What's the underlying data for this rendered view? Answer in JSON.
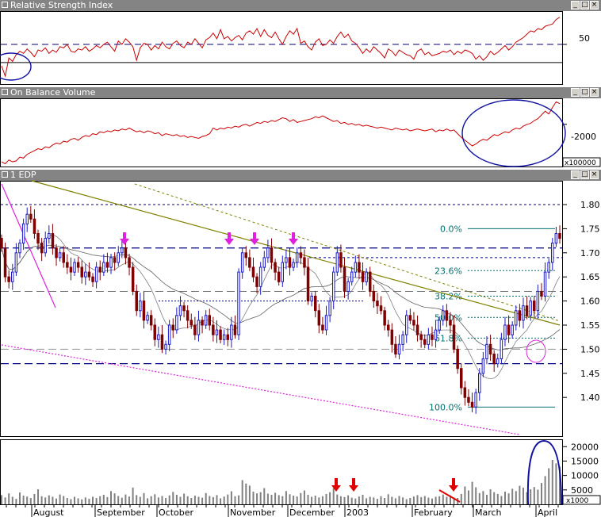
{
  "panels": {
    "rsi": {
      "title": "Relative Strength Index",
      "tick_label": "50"
    },
    "obv": {
      "title": "On Balance Volume",
      "tick_label": "-2000",
      "scale_label": "x100000"
    },
    "price": {
      "title": "1 EDP"
    },
    "volume": {
      "scale_label": "x1000"
    }
  },
  "window_controls": {
    "minimize": "_",
    "maximize": "□",
    "close": "×"
  },
  "colors": {
    "titlebar": "#848484",
    "rsi_line": "#cc0000",
    "obv_line": "#cc0000",
    "candle_up": "#1a1ac8",
    "candle_down": "#800000",
    "trend_olive": "#808000",
    "support_magenta": "#e020e0",
    "ellipse_navy": "#1010a0",
    "fib_teal": "#007070",
    "ma_gray": "#808080",
    "annotation_red": "#e00000",
    "grid_navy": "#000080"
  },
  "x_axis_labels": [
    "August",
    "September",
    "October",
    "November",
    "December",
    "2003",
    "February",
    "March",
    "April"
  ],
  "chart_data": [
    {
      "type": "line",
      "title": "Relative Strength Index",
      "yticks": [
        50
      ],
      "series": [
        {
          "values": [
            31,
            22,
            38,
            35,
            41,
            44,
            42,
            46,
            43,
            39,
            45,
            44,
            47,
            42,
            45,
            43,
            48,
            47,
            50,
            44,
            43,
            46,
            45,
            48,
            44,
            46,
            49,
            47,
            50,
            52,
            48,
            44,
            53,
            50,
            55,
            52,
            48,
            36,
            47,
            51,
            50,
            45,
            49,
            46,
            52,
            48,
            46,
            51,
            53,
            49,
            47,
            52,
            50,
            55,
            51,
            47,
            54,
            56,
            60,
            55,
            63,
            55,
            57,
            53,
            56,
            58,
            54,
            60,
            62,
            59,
            64,
            57,
            63,
            58,
            56,
            61,
            55,
            50,
            57,
            62,
            59,
            64,
            51,
            53,
            48,
            45,
            52,
            55,
            49,
            50,
            54,
            51,
            57,
            61,
            56,
            59,
            53,
            51,
            47,
            42,
            46,
            43,
            48,
            45,
            42,
            38,
            46,
            44,
            40,
            45,
            43,
            41,
            40,
            37,
            44,
            46,
            41,
            43,
            40,
            41,
            42,
            44,
            43,
            45,
            41,
            44,
            42,
            45,
            44,
            42,
            37,
            40,
            36,
            39,
            44,
            41,
            43,
            46,
            49,
            45,
            48,
            52,
            54,
            56,
            59,
            62,
            61,
            64,
            63,
            66,
            67,
            68,
            72,
            74
          ]
        }
      ]
    },
    {
      "type": "line",
      "title": "On Balance Volume",
      "yticks": [
        -2000
      ],
      "series": [
        {
          "values": [
            -2400,
            -2420,
            -2380,
            -2400,
            -2390,
            -2350,
            -2360,
            -2320,
            -2300,
            -2280,
            -2260,
            -2270,
            -2240,
            -2250,
            -2220,
            -2200,
            -2210,
            -2180,
            -2190,
            -2160,
            -2150,
            -2170,
            -2140,
            -2120,
            -2130,
            -2100,
            -2110,
            -2080,
            -2090,
            -2070,
            -2080,
            -2060,
            -2070,
            -2050,
            -2060,
            -2040,
            -2060,
            -2080,
            -2070,
            -2090,
            -2070,
            -2080,
            -2100,
            -2090,
            -2120,
            -2100,
            -2110,
            -2120,
            -2110,
            -2130,
            -2120,
            -2140,
            -2130,
            -2140,
            -2150,
            -2130,
            -2120,
            -2100,
            -2040,
            -2060,
            -2040,
            -2050,
            -2030,
            -2040,
            -2020,
            -2030,
            -2010,
            -2000,
            -2020,
            -2000,
            -1980,
            -1990,
            -1970,
            -1980,
            -1960,
            -1970,
            -1950,
            -1930,
            -1940,
            -1970,
            -1950,
            -1980,
            -1970,
            -1960,
            -1950,
            -1940,
            -1920,
            -1930,
            -1910,
            -1930,
            -1950,
            -1970,
            -1960,
            -1990,
            -1980,
            -2000,
            -1990,
            -2010,
            -2000,
            -2020,
            -2010,
            -2020,
            -2030,
            -2040,
            -2030,
            -2040,
            -2050,
            -2060,
            -2040,
            -2050,
            -2060,
            -2050,
            -2070,
            -2060,
            -2050,
            -2060,
            -2070,
            -2060,
            -2050,
            -2080,
            -2060,
            -2070,
            -2050,
            -2070,
            -2060,
            -2100,
            -2140,
            -2170,
            -2200,
            -2230,
            -2210,
            -2180,
            -2160,
            -2170,
            -2140,
            -2110,
            -2120,
            -2100,
            -2080,
            -2090,
            -2060,
            -2040,
            -2050,
            -2020,
            -2000,
            -1990,
            -1960,
            -1940,
            -1900,
            -1860,
            -1890,
            -1820,
            -1760,
            -1780
          ]
        }
      ]
    },
    {
      "type": "candlestick",
      "title": "1 EDP",
      "yticks": [
        1.4,
        1.45,
        1.5,
        1.55,
        1.6,
        1.65,
        1.7,
        1.75,
        1.8
      ],
      "fib_levels": [
        {
          "label": "0.0%",
          "value": 1.75
        },
        {
          "label": "23.6%",
          "value": 1.663
        },
        {
          "label": "38.2%",
          "value": 1.61
        },
        {
          "label": "50.0%",
          "value": 1.566
        },
        {
          "label": "61.8%",
          "value": 1.523
        },
        {
          "label": "100.0%",
          "value": 1.38
        }
      ],
      "horizontal_levels": [
        1.8,
        1.71,
        1.69,
        1.62,
        1.6,
        1.5,
        1.47
      ],
      "close": [
        1.71,
        1.65,
        1.64,
        1.66,
        1.7,
        1.72,
        1.76,
        1.78,
        1.77,
        1.74,
        1.72,
        1.7,
        1.73,
        1.74,
        1.71,
        1.69,
        1.7,
        1.68,
        1.67,
        1.66,
        1.68,
        1.67,
        1.65,
        1.66,
        1.65,
        1.64,
        1.67,
        1.66,
        1.68,
        1.67,
        1.69,
        1.68,
        1.7,
        1.71,
        1.69,
        1.67,
        1.62,
        1.58,
        1.6,
        1.56,
        1.57,
        1.55,
        1.52,
        1.53,
        1.5,
        1.51,
        1.55,
        1.54,
        1.57,
        1.59,
        1.58,
        1.56,
        1.55,
        1.53,
        1.56,
        1.55,
        1.57,
        1.55,
        1.53,
        1.54,
        1.52,
        1.53,
        1.52,
        1.55,
        1.53,
        1.66,
        1.7,
        1.69,
        1.67,
        1.65,
        1.63,
        1.67,
        1.69,
        1.71,
        1.68,
        1.66,
        1.64,
        1.68,
        1.69,
        1.67,
        1.68,
        1.7,
        1.69,
        1.67,
        1.6,
        1.61,
        1.58,
        1.55,
        1.54,
        1.57,
        1.6,
        1.66,
        1.7,
        1.67,
        1.62,
        1.64,
        1.66,
        1.68,
        1.66,
        1.64,
        1.66,
        1.62,
        1.6,
        1.59,
        1.58,
        1.55,
        1.54,
        1.51,
        1.49,
        1.51,
        1.53,
        1.57,
        1.56,
        1.55,
        1.53,
        1.52,
        1.51,
        1.53,
        1.52,
        1.54,
        1.56,
        1.58,
        1.56,
        1.55,
        1.5,
        1.46,
        1.42,
        1.4,
        1.39,
        1.38,
        1.41,
        1.45,
        1.48,
        1.51,
        1.49,
        1.47,
        1.48,
        1.52,
        1.55,
        1.53,
        1.55,
        1.58,
        1.56,
        1.59,
        1.57,
        1.6,
        1.58,
        1.62,
        1.61,
        1.66,
        1.68,
        1.72,
        1.74,
        1.73
      ]
    },
    {
      "type": "bar",
      "title": "",
      "yticks": [
        5000,
        10000,
        15000,
        20000
      ],
      "values": [
        3200,
        2400,
        3800,
        2600,
        1900,
        4100,
        3000,
        2700,
        2200,
        3600,
        5200,
        2800,
        2400,
        3100,
        2600,
        2000,
        3400,
        2900,
        2200,
        1800,
        2600,
        2100,
        1700,
        2400,
        1900,
        2600,
        2200,
        2800,
        3300,
        2500,
        4600,
        3800,
        2900,
        2300,
        3400,
        2700,
        5800,
        3200,
        2600,
        3900,
        2100,
        2800,
        3500,
        2400,
        2900,
        2200,
        3100,
        4300,
        3300,
        2600,
        3700,
        2800,
        2200,
        3000,
        2600,
        2300,
        3900,
        2900,
        2500,
        3200,
        2100,
        2700,
        3400,
        4500,
        2800,
        3100,
        8400,
        7200,
        6500,
        4400,
        3800,
        4200,
        5600,
        3700,
        3300,
        4000,
        3200,
        2800,
        4600,
        3500,
        3000,
        2700,
        3900,
        4800,
        3300,
        2600,
        3000,
        2400,
        2800,
        3600,
        4200,
        5600,
        3400,
        2800,
        2500,
        3100,
        2300,
        2000,
        2700,
        3300,
        2100,
        2600,
        2400,
        1900,
        2800,
        2200,
        3500,
        2600,
        2100,
        2900,
        2400,
        1800,
        2200,
        2700,
        3200,
        2500,
        2900,
        2300,
        2000,
        2600,
        2800,
        3400,
        2600,
        3100,
        2400,
        2200,
        3600,
        6200,
        4800,
        7800,
        5900,
        3900,
        4600,
        3300,
        5200,
        4200,
        3600,
        2900,
        4400,
        3800,
        5400,
        4600,
        6400,
        5800,
        4200,
        5200,
        6000,
        5100,
        7400,
        9800,
        12500,
        15400,
        14200,
        13100
      ]
    }
  ]
}
